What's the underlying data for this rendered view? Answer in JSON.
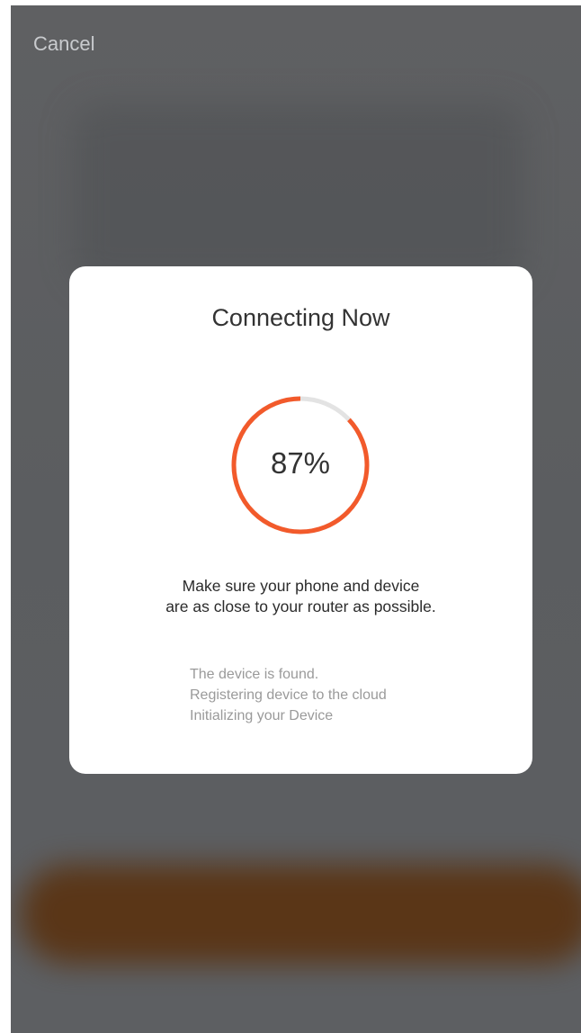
{
  "header": {
    "cancel_label": "Cancel"
  },
  "modal": {
    "title": "Connecting Now",
    "progress": {
      "value": 87,
      "label": "87%"
    },
    "instruction_line1": "Make sure your phone and device",
    "instruction_line2": "are as close to your router as possible.",
    "status_lines": [
      "The device is found.",
      "Registering device to the cloud",
      "Initializing your Device"
    ]
  },
  "colors": {
    "accent": "#f25a2b",
    "track": "#e3e3e3",
    "overlay": "#5f6062",
    "blurred_button": "#5a3414"
  },
  "icons": {
    "progress_ring": "progress-ring-icon"
  }
}
